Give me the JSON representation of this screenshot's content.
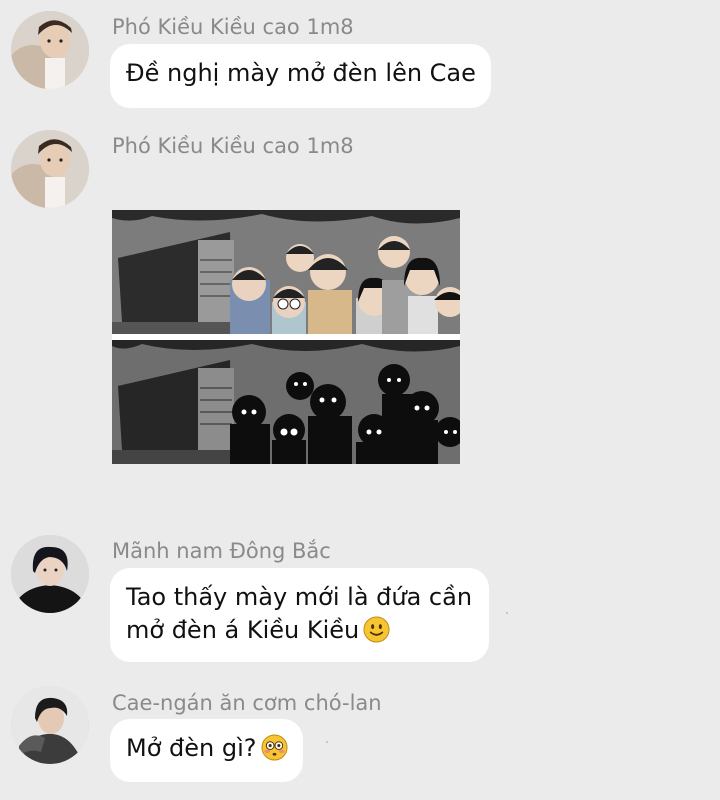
{
  "messages": [
    {
      "sender": "Phó Kiều Kiều cao 1m8",
      "text": "Đề nghị mày mở đèn lên Cae"
    },
    {
      "sender": "Phó Kiều Kiều cao 1m8"
    },
    {
      "sender": "Mãnh nam Đông Bắc",
      "lines": [
        "Tao thấy mày mới là đứa cần",
        "mở đèn á Kiều Kiều"
      ],
      "emoji": "slightly-smiling-face"
    },
    {
      "sender": "Cae-ngán ăn cơm chó-lan",
      "text": "Mở đèn gì?",
      "emoji": "flushed-face"
    }
  ],
  "colors": {
    "background": "#ebebeb",
    "bubble": "#ffffff",
    "sender_name": "#8a8a8a",
    "text": "#111111"
  }
}
